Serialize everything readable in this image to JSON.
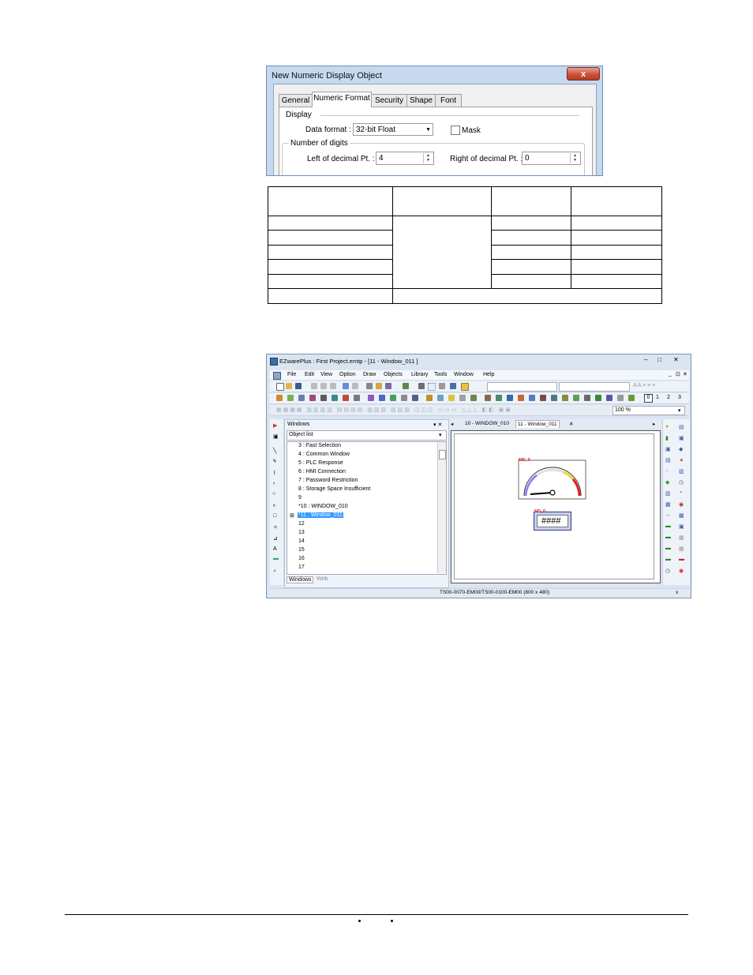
{
  "dialog": {
    "title": "New  Numeric Display Object",
    "close_label": "x",
    "tabs": [
      {
        "label": "General"
      },
      {
        "label": "Numeric Format"
      },
      {
        "label": "Security"
      },
      {
        "label": "Shape"
      },
      {
        "label": "Font"
      }
    ],
    "display_heading": "Display",
    "data_format_label": "Data format :",
    "data_format_value": "32-bit Float",
    "mask_label": "Mask",
    "digits_heading": "Number of digits",
    "left_label": "Left of decimal Pt. :",
    "left_value": "4",
    "right_label": "Right of decimal Pt. :",
    "right_value": "0"
  },
  "app": {
    "title": "EZwarePlus : First Project.emtp - [11 - Window_011 ]",
    "win_controls": [
      "–",
      "□",
      "✕"
    ],
    "menu_controls": [
      "_",
      "⊡",
      "✕"
    ],
    "menu": [
      "File",
      "Edit",
      "View",
      "Option",
      "Draw",
      "Objects",
      "Library",
      "Tools",
      "Window",
      "Help"
    ],
    "zoom": "100 %",
    "digit_buttons": [
      "0",
      "1",
      "2",
      "3"
    ],
    "panel_title": "Windows",
    "panel_controls": "▾ ✕",
    "object_list": "Object list",
    "tree": [
      "3 : Fast Selection",
      "4 : Common Window",
      "5 : PLC Response",
      "6 : HMI Connection",
      "7 : Password Restriction",
      "8 : Storage Space Insufficient",
      "9",
      "*10 : WINDOW_010",
      "*11 : Window_011",
      "12",
      "13",
      "14",
      "15",
      "16",
      "17"
    ],
    "bottom_tabs": [
      "Windows",
      "Web"
    ],
    "doc_tabs": [
      "10 - WINDOW_010",
      "11 - Window_011"
    ],
    "doc_tab_close": "✕",
    "meter_label": "MD_0",
    "numeric_label": "ND_0",
    "numeric_text": "####",
    "status": "TS00-0070-EM00/TS00-0100-EM00 (800 x 480)",
    "status_x": "x"
  }
}
